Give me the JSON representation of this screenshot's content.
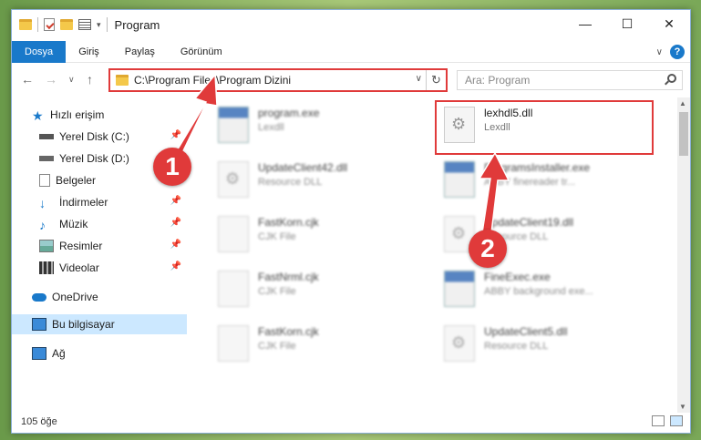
{
  "window": {
    "title": "Program"
  },
  "ribbon": {
    "tabs": [
      "Dosya",
      "Giriş",
      "Paylaş",
      "Görünüm"
    ],
    "help": "?"
  },
  "address": {
    "path": "C:\\Program Files\\Program Dizini"
  },
  "search": {
    "placeholder": "Ara: Program"
  },
  "sidebar": {
    "quick_access": "Hızlı erişim",
    "items": [
      "Yerel Disk (C:)",
      "Yerel Disk (D:)",
      "Belgeler",
      "İndirmeler",
      "Müzik",
      "Resimler",
      "Videolar"
    ],
    "onedrive": "OneDrive",
    "this_pc": "Bu bilgisayar",
    "network": "Ağ"
  },
  "files": [
    {
      "name": "program.exe",
      "type": "Lexdll",
      "kind": "exe"
    },
    {
      "name": "lexhdl5.dll",
      "type": "Lexdll",
      "kind": "dll"
    },
    {
      "name": "UpdateClient42.dll",
      "type": "Resource DLL",
      "kind": "dll"
    },
    {
      "name": "ProgramsInstaller.exe",
      "type": "ABBY finereader tr...",
      "kind": "exe"
    },
    {
      "name": "FastKorn.cjk",
      "type": "CJK File",
      "kind": "file"
    },
    {
      "name": "UpdateClient19.dll",
      "type": "Resource DLL",
      "kind": "dll"
    },
    {
      "name": "FastNrml.cjk",
      "type": "CJK File",
      "kind": "file"
    },
    {
      "name": "FineExec.exe",
      "type": "ABBY background exe...",
      "kind": "exe"
    },
    {
      "name": "FastKorn.cjk",
      "type": "CJK File",
      "kind": "file"
    },
    {
      "name": "UpdateClient5.dll",
      "type": "Resource DLL",
      "kind": "dll"
    }
  ],
  "status": {
    "count": "105 öğe"
  },
  "annotations": {
    "one": "1",
    "two": "2"
  },
  "colors": {
    "accent": "#1979ca",
    "highlight": "#e03a3a",
    "selected": "#cce8ff"
  }
}
